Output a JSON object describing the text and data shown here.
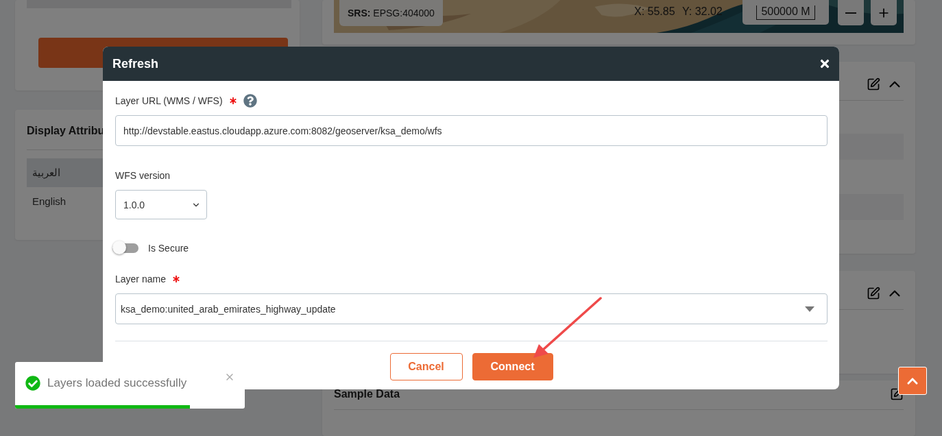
{
  "left_panel": {
    "display_attributes": {
      "title": "Display Attribu",
      "rows": [
        {
          "label": "العربية",
          "selected": true
        },
        {
          "label": "English",
          "selected": false
        }
      ]
    }
  },
  "map": {
    "srs": "**SRS:** EPSG:404000",
    "x": "X: 55.85",
    "y": "Y: 32.02",
    "scale": "500000 M"
  },
  "sections": [
    {
      "expanded": true
    },
    {
      "expanded": true
    },
    {
      "title": "Sample Data"
    }
  ],
  "dialog": {
    "title": "Refresh",
    "fields": [
      {
        "kind": "text",
        "label": "Layer URL (WMS / WFS)",
        "required": true,
        "help": true,
        "value": "http://devstable.eastus.cloudapp.azure.com:8082/geoserver/ksa_demo/wfs"
      },
      {
        "kind": "select",
        "label": "WFS version",
        "value": "1.0.0"
      },
      {
        "kind": "switch",
        "label": "Is Secure",
        "on": false
      },
      {
        "kind": "combo",
        "label": "Layer name",
        "required": true,
        "value": "ksa_demo:united_arab_emirates_highway_update"
      }
    ],
    "buttons": [
      {
        "label": "Cancel",
        "kind": "outline"
      },
      {
        "label": "Connect",
        "kind": "primary"
      }
    ]
  },
  "toast": {
    "message": "Layers loaded successfully",
    "level": 0.76
  }
}
